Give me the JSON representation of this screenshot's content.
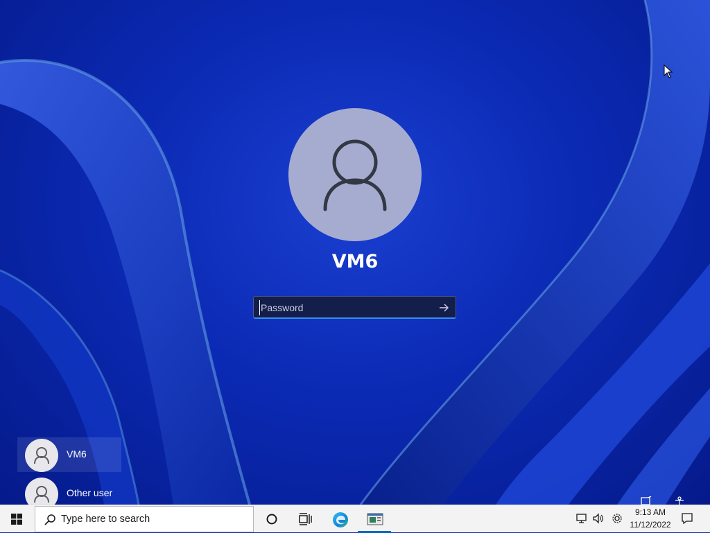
{
  "lock_screen": {
    "user_name": "VM6",
    "password_placeholder": "Password",
    "password_value": ""
  },
  "user_list": [
    {
      "name": "VM6",
      "selected": true
    },
    {
      "name": "Other user",
      "selected": false
    }
  ],
  "taskbar": {
    "search_placeholder": "Type here to search",
    "pinned": [
      {
        "name": "cortana-icon"
      },
      {
        "name": "task-view-icon"
      },
      {
        "name": "edge-icon"
      },
      {
        "name": "app-window-icon",
        "active": true
      }
    ],
    "tray": {
      "icons": [
        "network-icon",
        "volume-icon",
        "settings-gear-icon"
      ],
      "time": "9:13 AM",
      "date": "11/12/2022"
    }
  },
  "colors": {
    "wallpaper": "#0b2ab4",
    "accent": "#0067c0",
    "avatar_bg": "#a6acd0",
    "taskbar_bg": "#f3f3f3"
  }
}
